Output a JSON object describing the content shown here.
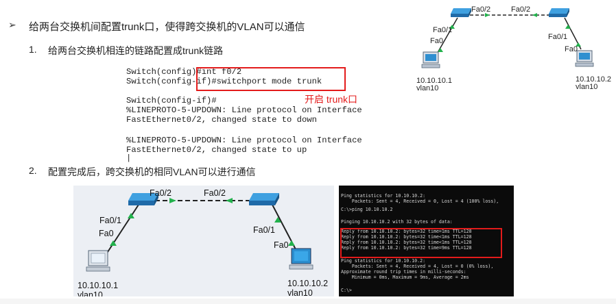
{
  "heading": {
    "arrow": "➢",
    "text": "给两台交换机间配置trunk口，使得跨交换机的VLAN可以通信"
  },
  "steps": [
    {
      "num": "1.",
      "text": "给两台交换机相连的链路配置成trunk链路"
    },
    {
      "num": "2.",
      "text": "配置完成后，跨交换机的相同VLAN可以进行通信"
    }
  ],
  "cli": {
    "lines": [
      "Switch(config)#int f0/2",
      "Switch(config-if)#switchport mode trunk",
      "",
      "Switch(config-if)#",
      "%LINEPROTO-5-UPDOWN: Line protocol on Interface",
      "FastEthernet0/2, changed state to down",
      "",
      "%LINEPROTO-5-UPDOWN: Line protocol on Interface",
      "FastEthernet0/2, changed state to up",
      "|"
    ],
    "annotation": "开启 trunk口"
  },
  "topology_small": {
    "sw_left_port": "Fa0/2",
    "sw_right_port": "Fa0/2",
    "left_uplink": "Fa0/1",
    "left_pc_port": "Fa0",
    "right_uplink": "Fa0/1",
    "right_pc_port": "Fa0",
    "pc_left_ip": "10.10.10.1",
    "pc_left_vlan": "vlan10",
    "pc_right_ip": "10.10.10.2",
    "pc_right_vlan": "vlan10"
  },
  "topology_big": {
    "sw_left_port": "Fa0/2",
    "sw_right_port": "Fa0/2",
    "left_uplink": "Fa0/1",
    "left_pc_port": "Fa0",
    "right_uplink": "Fa0/1",
    "right_pc_port": "Fa0",
    "pc_left_ip": "10.10.10.1",
    "pc_left_vlan": "vlan10",
    "pc_right_ip": "10.10.10.2",
    "pc_right_vlan": "vlan10"
  },
  "terminal": {
    "lines": [
      "Ping statistics for 10.10.10.2:",
      "    Packets: Sent = 4, Received = 0, Lost = 4 (100% loss),",
      "",
      "C:\\>ping 10.10.10.2",
      "",
      "Pinging 10.10.10.2 with 32 bytes of data:",
      "",
      "Reply from 10.10.10.2: bytes=32 time=1ms TTL=128",
      "Reply from 10.10.10.2: bytes=32 time<1ms TTL=128",
      "Reply from 10.10.10.2: bytes=32 time<1ms TTL=128",
      "Reply from 10.10.10.2: bytes=32 time=9ms TTL=128",
      "",
      "Ping statistics for 10.10.10.2:",
      "    Packets: Sent = 4, Received = 4, Lost = 0 (0% loss),",
      "Approximate round trip times in milli-seconds:",
      "    Minimum = 0ms, Maximum = 9ms, Average = 2ms",
      "",
      "",
      "C:\\>"
    ]
  },
  "colors": {
    "accent_red": "#e31b1b",
    "link_green": "#22b14c",
    "switch_blue": "#2a8fd6"
  }
}
